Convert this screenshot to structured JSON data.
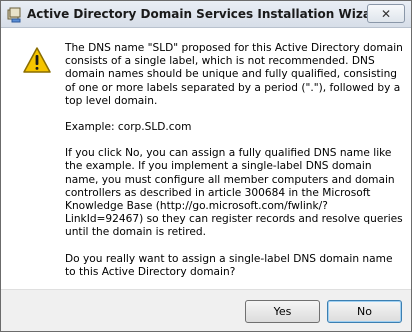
{
  "window": {
    "title": "Active Directory Domain Services Installation Wizard",
    "close_label": "✕"
  },
  "icons": {
    "title": "ad-wizard-icon",
    "message": "warning-icon"
  },
  "message": {
    "paragraphs": [
      "The DNS name \"SLD\" proposed for this Active Directory domain consists of a single label, which is not recommended. DNS domain names should be unique and fully qualified, consisting of one or more labels separated by a period (\".\"), followed by a top level domain.",
      "Example: corp.SLD.com",
      "If you click No, you can assign a fully qualified DNS name like the example. If you implement a single-label DNS domain name, you must configure all member computers and domain controllers as described in article 300684 in the Microsoft Knowledge Base (http://go.microsoft.com/fwlink/?LinkId=92467) so they can register records and resolve queries until the domain is retired.",
      "Do you really want to assign a single-label DNS domain name to this Active Directory domain?"
    ]
  },
  "buttons": {
    "yes": "Yes",
    "no": "No"
  },
  "colors": {
    "warning_fill": "#f5c400",
    "warning_outline": "#8a6d00"
  }
}
